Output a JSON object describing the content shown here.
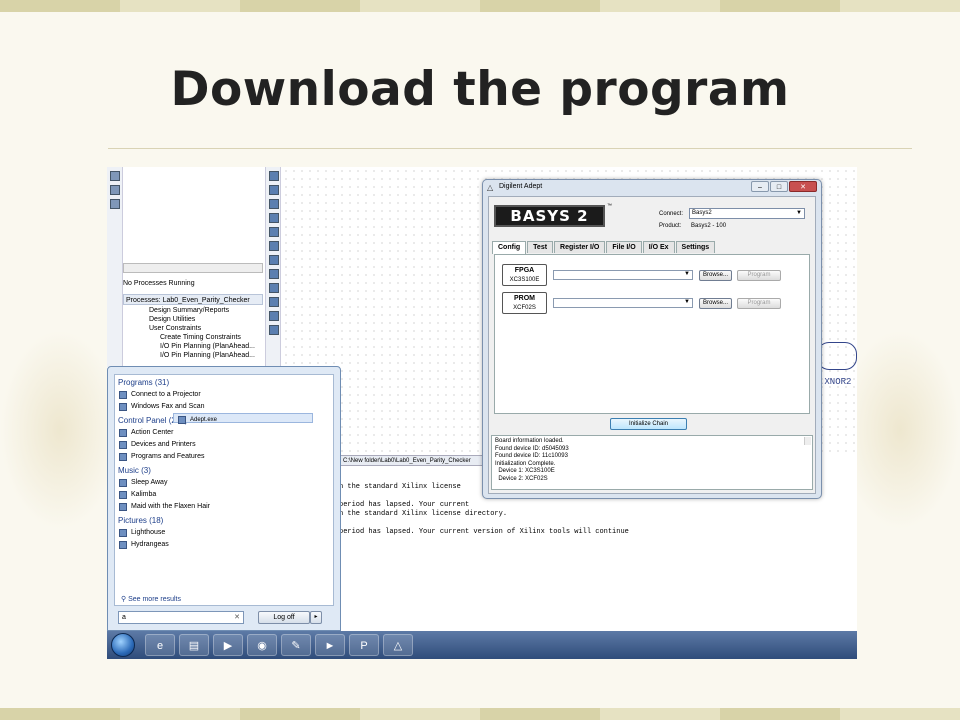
{
  "slide": {
    "title": "Download the program"
  },
  "ise": {
    "process_status": "No Processes Running",
    "processes_title": "Processes: Lab0_Even_Parity_Checker",
    "process_items": [
      "Design Summary/Reports",
      "Design Utilities",
      "User Constraints",
      "Create Timing Constraints",
      "I/O Pin Planning (PlanAhead...",
      "I/O Pin Planning (PlanAhead..."
    ],
    "path": "C:\\New folder\\Lab0\\Lab0_Even_Parity_Checker",
    "canvas_label": ".XNOR2",
    "console_lines": [
      "n the standard Xilinx license",
      "",
      "period has lapsed. Your current",
      "n the standard Xilinx license directory.",
      "",
      "period has lapsed. Your current version of Xilinx tools will continue"
    ]
  },
  "start_menu": {
    "groups": [
      {
        "header": "Programs (31)",
        "items": [
          "Connect to a Projector",
          "Windows Fax and Scan",
          "Adept.exe"
        ]
      },
      {
        "header": "Control Panel (262)",
        "items": [
          "Action Center",
          "Devices and Printers",
          "Programs and Features"
        ]
      },
      {
        "header": "Music (3)",
        "items": [
          "Sleep Away",
          "Kalimba",
          "Maid with the Flaxen Hair"
        ]
      },
      {
        "header": "Pictures (18)",
        "items": [
          "Lighthouse",
          "Hydrangeas"
        ]
      }
    ],
    "see_more": "See more results",
    "search_value": "a",
    "logoff_label": "Log off"
  },
  "adept": {
    "window_title": "Digilent Adept",
    "logo": "BASYS 2",
    "connect_label": "Connect:",
    "connect_value": "Basys2",
    "product_label": "Product:",
    "product_value": "Basys2 - 100",
    "tabs": [
      "Config",
      "Test",
      "Register I/O",
      "File I/O",
      "I/O Ex",
      "Settings"
    ],
    "devices": [
      {
        "name": "FPGA",
        "part": "XC3S100E"
      },
      {
        "name": "PROM",
        "part": "XCF02S"
      }
    ],
    "browse_label": "Browse...",
    "program_label": "Program",
    "init_chain_label": "Initialize Chain",
    "log_lines": [
      "Board information loaded.",
      "Found device ID: d5045093",
      "Found device ID: 11c10093",
      "Initialization Complete.",
      "  Device 1: XC3S100E",
      "  Device 2: XCF02S"
    ]
  }
}
